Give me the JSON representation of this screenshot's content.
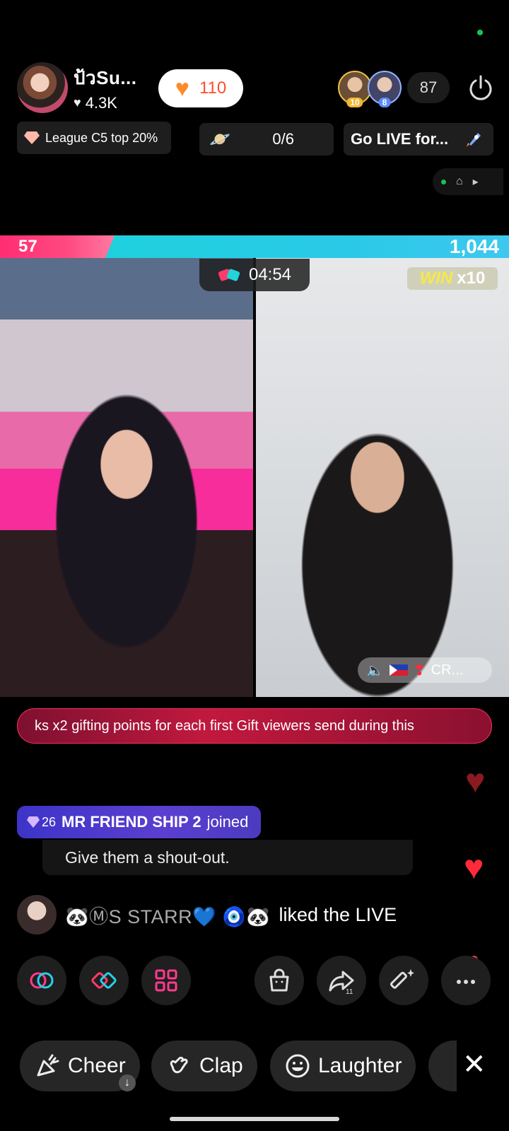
{
  "host": {
    "name": "ป้วSu...",
    "likes": "4.3K",
    "like_count": "110"
  },
  "viewers": {
    "badges": [
      "10",
      "8"
    ],
    "count": "87"
  },
  "league": {
    "label": "League C5 top 20%"
  },
  "goal": {
    "progress": "0/6"
  },
  "go_live": {
    "label": "Go LIVE for..."
  },
  "battle": {
    "left_score": "57",
    "right_score": "1,044",
    "timer": "04:54",
    "win_label": "WIN",
    "win_multiplier": "x10",
    "right_tag": "CR..."
  },
  "ticker": {
    "text": "ks x2 gifting points for each first Gift viewers send during this"
  },
  "chat": {
    "join_level": "26",
    "join_name": "MR FRIEND SHIP 2",
    "join_suffix": "joined",
    "shout_out": "Give them a shout-out.",
    "liked_name": "🐼ⓂS STARR💙 🧿🐼",
    "liked_text": "liked the LIVE"
  },
  "toolbar": {
    "share_count": "11"
  },
  "reactions": [
    {
      "label": "Cheer",
      "icon": "cheer-icon"
    },
    {
      "label": "Clap",
      "icon": "clap-icon"
    },
    {
      "label": "Laughter",
      "icon": "laughter-icon"
    }
  ],
  "colors": {
    "accent_pink": "#ff2d73",
    "accent_cyan": "#19d4d8",
    "join_purple": "#4b3bc0",
    "ticker_red": "#c1193e"
  }
}
